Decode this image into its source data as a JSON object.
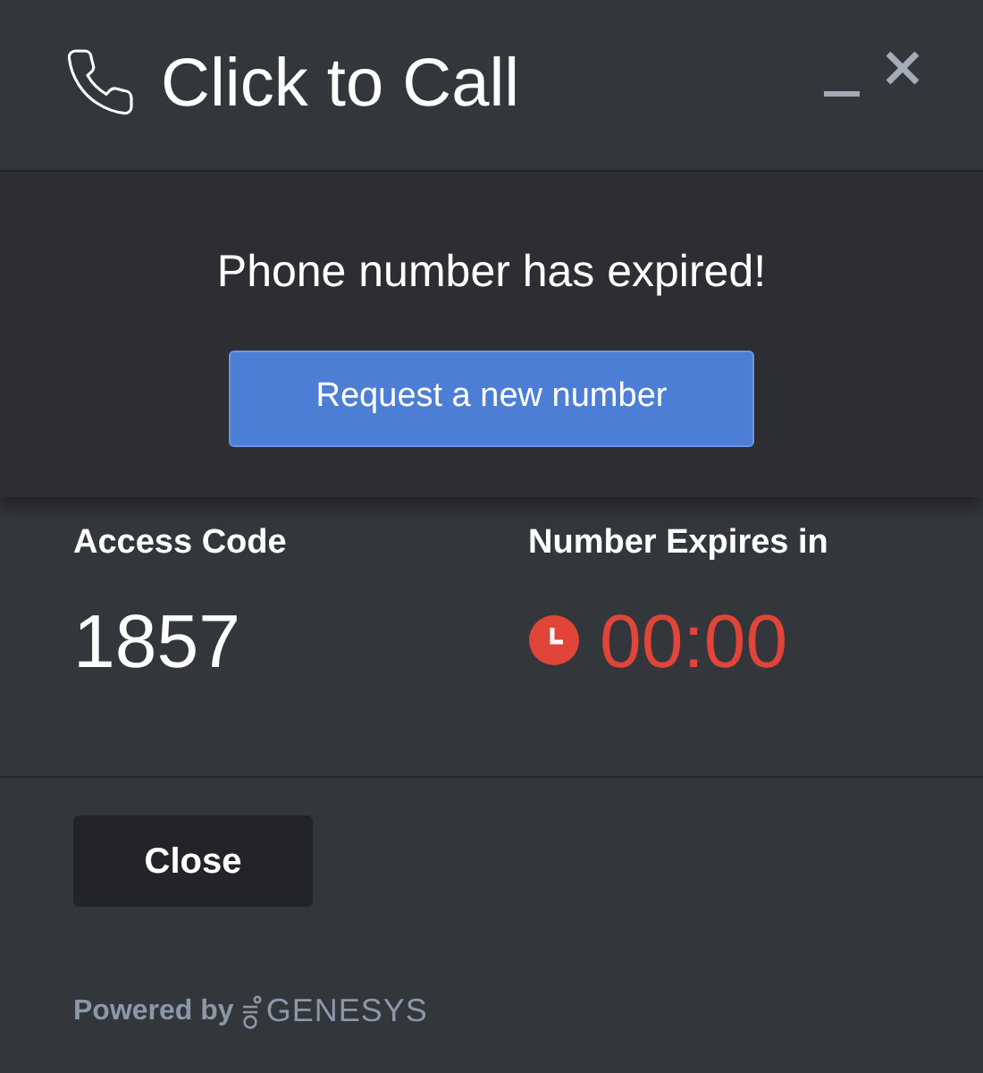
{
  "header": {
    "title": "Click to Call"
  },
  "alert": {
    "message": "Phone number has expired!",
    "button": "Request a new number"
  },
  "info": [
    {
      "label": "Access Code",
      "value": "1857",
      "kind": "code"
    },
    {
      "label": "Number Expires in",
      "value": "00:00",
      "kind": "timer"
    }
  ],
  "footer": {
    "button": "Close",
    "powered_by": "Powered by",
    "brand": "GENESYS"
  }
}
